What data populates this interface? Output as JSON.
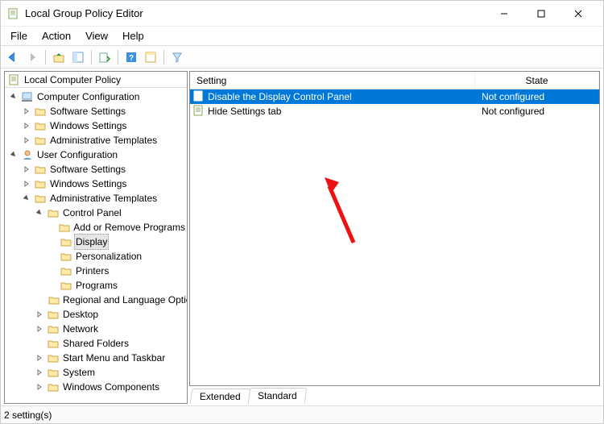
{
  "window": {
    "title": "Local Group Policy Editor"
  },
  "menubar": {
    "file": "File",
    "action": "Action",
    "view": "View",
    "help": "Help"
  },
  "tree": {
    "root": "Local Computer Policy",
    "cc": "Computer Configuration",
    "cc_sw": "Software Settings",
    "cc_win": "Windows Settings",
    "cc_adm": "Administrative Templates",
    "uc": "User Configuration",
    "uc_sw": "Software Settings",
    "uc_win": "Windows Settings",
    "uc_adm": "Administrative Templates",
    "cp": "Control Panel",
    "cp_addremove": "Add or Remove Programs",
    "cp_display": "Display",
    "cp_personalization": "Personalization",
    "cp_printers": "Printers",
    "cp_programs": "Programs",
    "cp_regional": "Regional and Language Options",
    "desktop": "Desktop",
    "network": "Network",
    "shared": "Shared Folders",
    "startmenu": "Start Menu and Taskbar",
    "system": "System",
    "wincomp": "Windows Components"
  },
  "list": {
    "col_setting": "Setting",
    "col_state": "State",
    "rows": [
      {
        "setting": "Disable the Display Control Panel",
        "state": "Not configured",
        "selected": true
      },
      {
        "setting": "Hide Settings tab",
        "state": "Not configured",
        "selected": false
      }
    ]
  },
  "tabs": {
    "extended": "Extended",
    "standard": "Standard"
  },
  "status": {
    "text": "2 setting(s)"
  }
}
